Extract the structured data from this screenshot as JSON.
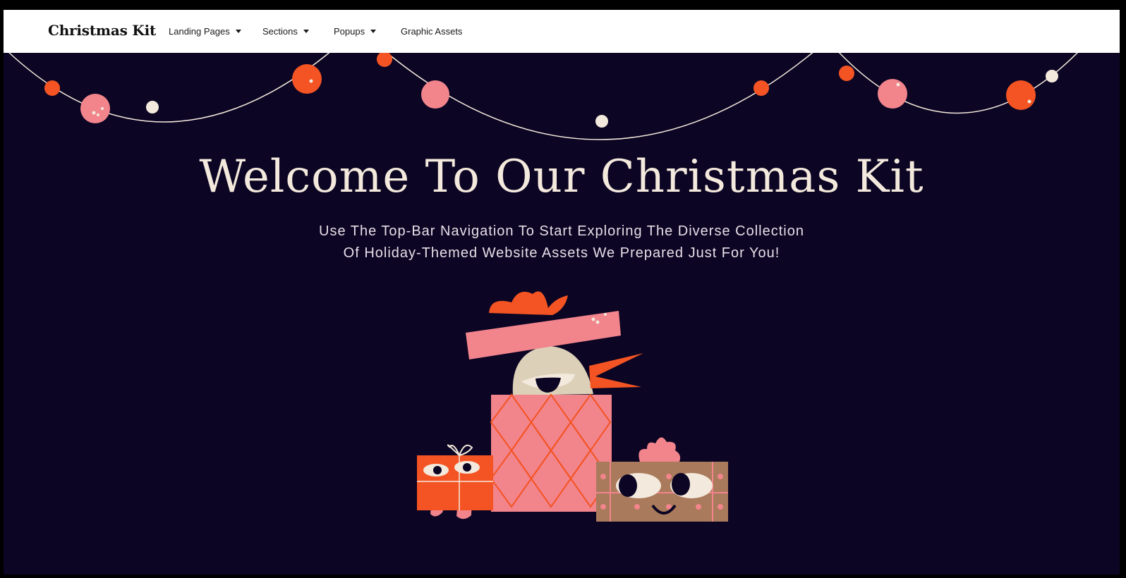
{
  "brand": "Christmas Kit",
  "nav": [
    {
      "label": "Landing Pages",
      "has_dropdown": true
    },
    {
      "label": "Sections",
      "has_dropdown": true
    },
    {
      "label": "Popups",
      "has_dropdown": true
    },
    {
      "label": "Graphic Assets",
      "has_dropdown": false
    }
  ],
  "hero": {
    "title": "Welcome To Our Christmas Kit",
    "subtitle_line1": "Use The Top-Bar Navigation To Start Exploring The Diverse Collection",
    "subtitle_line2": "Of Holiday-Themed Website Assets We Prepared Just For You!"
  },
  "colors": {
    "background": "#0c0523",
    "orange": "#f45423",
    "pink": "#f2848c",
    "cream": "#f3e9dc",
    "brown": "#a97a5b",
    "beige": "#ddd0b8"
  },
  "icons": {
    "caret": "caret-down-icon",
    "garland": "string-lights-garland",
    "illustration": "christmas-gift-characters"
  }
}
